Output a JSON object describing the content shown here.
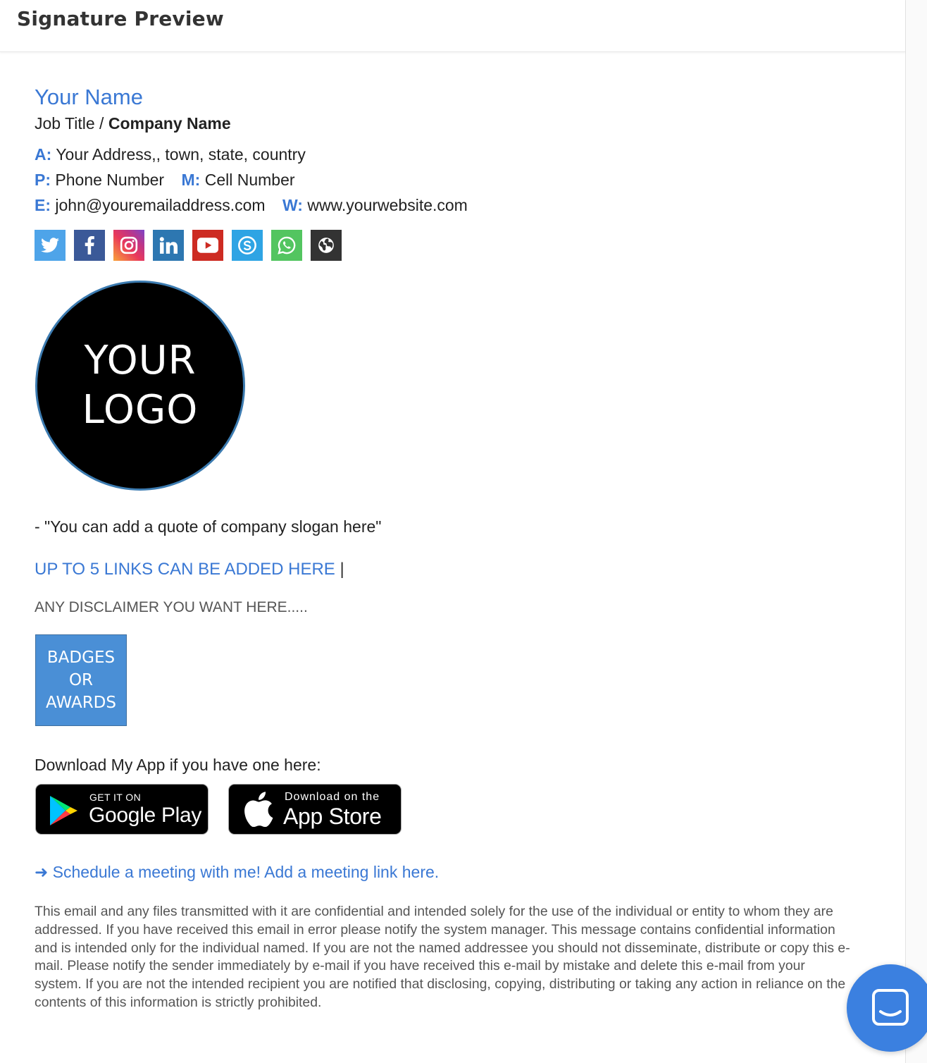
{
  "header": {
    "title": "Signature Preview"
  },
  "signature": {
    "name": "Your Name",
    "job_title": "Job Title / ",
    "company": "Company Name",
    "address_label": "A:",
    "address": "Your Address,, town, state, country",
    "phone_label": "P:",
    "phone": "Phone Number",
    "cell_label": "M:",
    "cell": "Cell Number",
    "email_label": "E:",
    "email": "john@youremailaddress.com",
    "web_label": "W:",
    "website": "www.yourwebsite.com",
    "socials": [
      {
        "icon": "twitter-icon",
        "color": "#4ea4e9"
      },
      {
        "icon": "facebook-icon",
        "color": "#3b5998"
      },
      {
        "icon": "instagram-icon",
        "color": "#d6249f"
      },
      {
        "icon": "linkedin-icon",
        "color": "#2d77b1"
      },
      {
        "icon": "youtube-icon",
        "color": "#cd2b22"
      },
      {
        "icon": "skype-icon",
        "color": "#2ea4e4"
      },
      {
        "icon": "whatsapp-icon",
        "color": "#53c560"
      },
      {
        "icon": "website-globe-icon",
        "color": "#333333"
      }
    ],
    "logo_line1": "YOUR",
    "logo_line2": "LOGO",
    "quote": "- \"You can add a quote of company slogan here\"",
    "links_text": "UP TO 5 LINKS CAN BE ADDED HERE",
    "links_separator": "|",
    "disclaimer_short": "ANY DISCLAIMER YOU WANT HERE.....",
    "badge_lines": [
      "BADGES",
      "OR",
      "AWARDS"
    ],
    "download_text": "Download My App if you have one here:",
    "google_play_small": "GET IT ON",
    "google_play_big": "Google Play",
    "app_store_small": "Download on the",
    "app_store_big": "App Store",
    "meeting_arrow": "➜",
    "meeting_text": "Schedule a meeting with me! Add a meeting link here.",
    "legal": "This email and any files transmitted with it are confidential and intended solely for the use of the individual or entity to whom they are addressed. If you have received this email in error please notify the system manager. This message contains confidential information and is intended only for the individual named. If you are not the named addressee you should not disseminate, distribute or copy this e-mail. Please notify the sender immediately by e-mail if you have received this e-mail by mistake and delete this e-mail from your system. If you are not the intended recipient you are notified that disclosing, copying, distributing or taking any action in reliance on the contents of this information is strictly prohibited."
  },
  "colors": {
    "accent": "#3a78d4",
    "chat_bubble": "#3b80e0"
  }
}
